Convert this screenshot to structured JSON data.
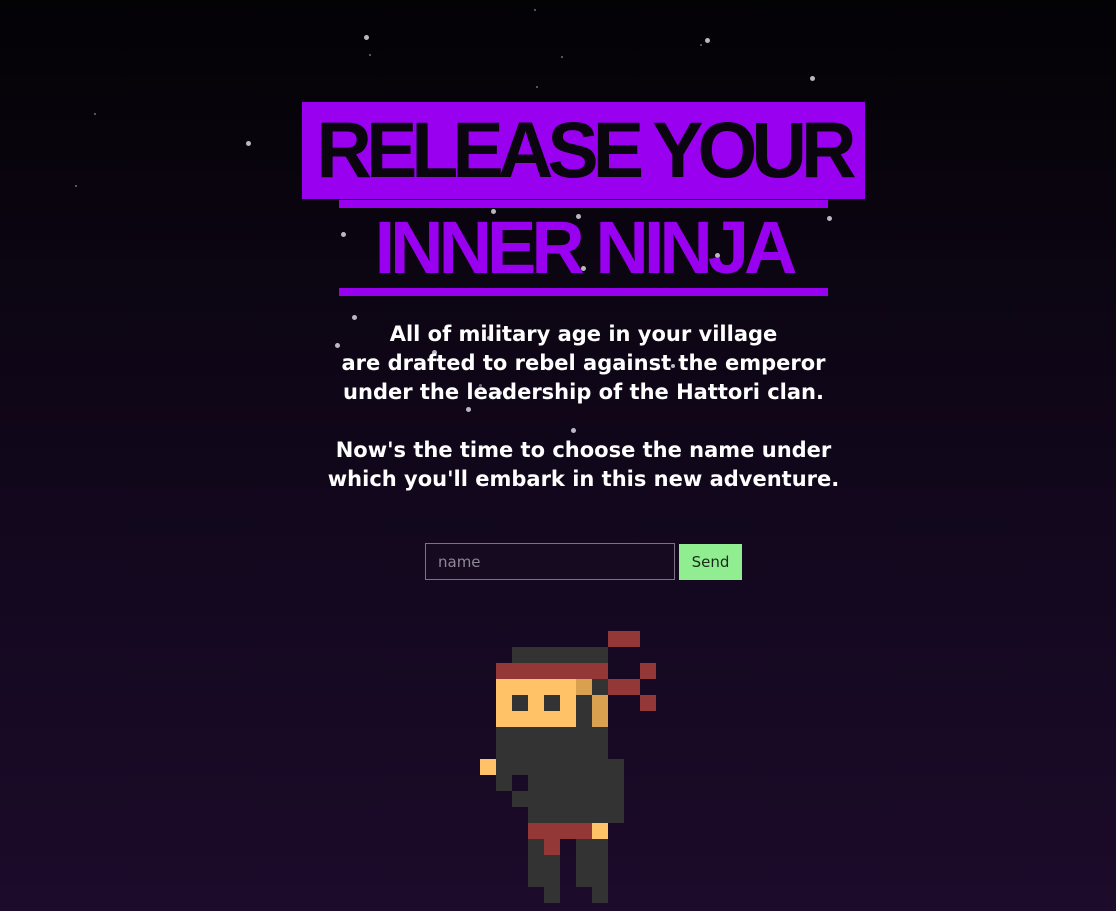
{
  "hero": {
    "title_line_1": "RELEASE YOUR",
    "title_line_2": "INNER NINJA"
  },
  "intro": {
    "paragraph_1": [
      "All of military age in your village",
      "are drafted to rebel against the emperor",
      "under the leadership of the Hattori clan."
    ],
    "paragraph_2": [
      "Now's the time to choose the name under",
      "which you'll embark in this new adventure."
    ]
  },
  "form": {
    "name_placeholder": "name",
    "name_value": "",
    "send_label": "Send"
  },
  "colors": {
    "accent_purple": "#9900f0",
    "send_button_green": "#90ee90",
    "background_top": "#030205",
    "background_bottom": "#1c0b2a"
  },
  "icons": {
    "ninja": "pixel-ninja-icon"
  }
}
